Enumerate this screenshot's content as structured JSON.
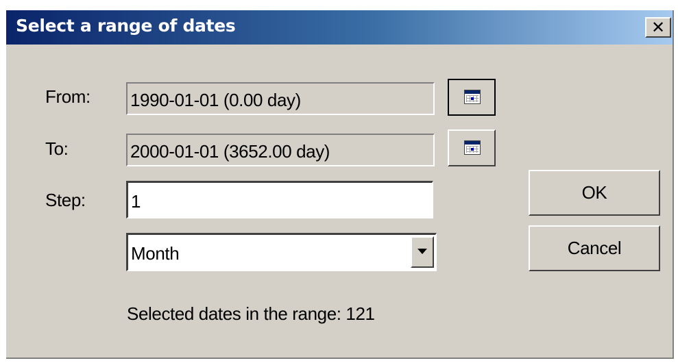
{
  "window": {
    "title": "Select a range of dates",
    "close_label": "✕"
  },
  "form": {
    "from_label": "From:",
    "from_value": "1990-01-01  (0.00 day)",
    "to_label": "To:",
    "to_value": "2000-01-01  (3652.00 day)",
    "step_label": "Step:",
    "step_value": "1",
    "unit_selected": "Month",
    "status_text": "Selected dates in the range: 121"
  },
  "buttons": {
    "ok": "OK",
    "cancel": "Cancel"
  },
  "icons": {
    "from_picker": "calendar-icon",
    "to_picker": "calendar-icon",
    "dropdown": "chevron-down-icon",
    "close": "close-icon"
  },
  "colors": {
    "title_gradient_start": "#0a246a",
    "title_gradient_end": "#a6caf0",
    "dialog_face": "#d4d0c8"
  }
}
